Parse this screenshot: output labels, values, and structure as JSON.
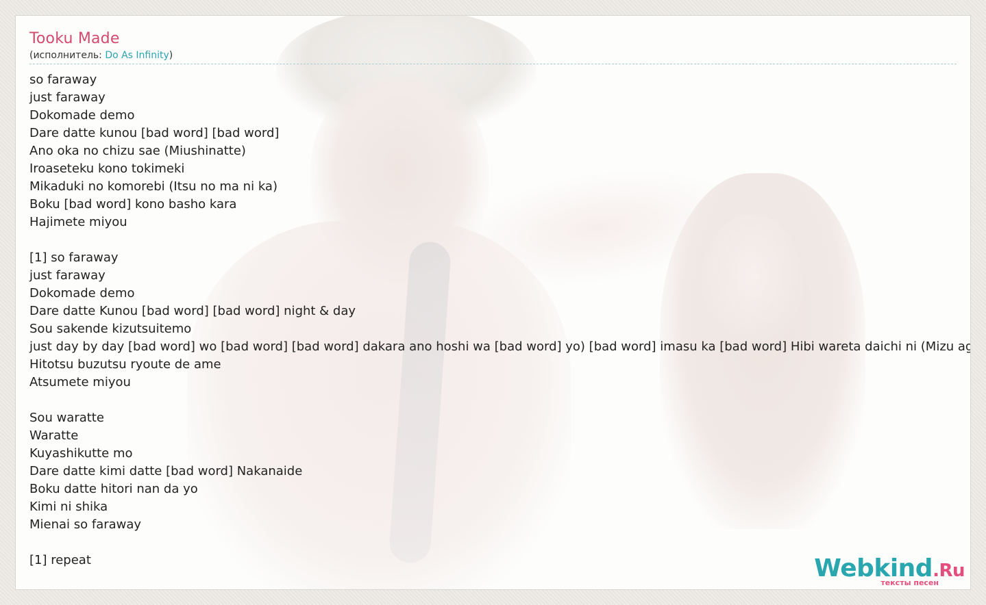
{
  "song": {
    "title": "Tooku Made",
    "artist_prefix": "(исполнитель: ",
    "artist_name": "Do As Infinity",
    "artist_suffix": ")"
  },
  "lyrics": [
    "so faraway",
    "just faraway",
    "Dokomade demo",
    "Dare datte kunou [bad word] [bad word]",
    "Ano oka no chizu sae (Miushinatte)",
    "Iroaseteku kono tokimeki",
    "Mikaduki no komorebi (Itsu no ma ni ka)",
    "Boku [bad word] kono basho kara",
    "Hajimete miyou",
    "",
    "[1] so faraway",
    "just faraway",
    "Dokomade demo",
    "Dare datte Kunou [bad word] [bad word] night & day",
    "Sou sakende kizutsuitemo",
    "just day by day [bad word] wo [bad word]  [bad word] dakara ano hoshi wa [bad word] yo) [bad word] imasu ka [bad word] Hibi wareta daichi ni (Mizu ageyou)",
    "Hitotsu buzutsu ryoute de ame",
    "Atsumete miyou",
    "",
    "Sou waratte",
    "Waratte",
    "Kuyashikutte mo",
    "Dare datte kimi datte [bad word] Nakanaide",
    "Boku datte hitori nan da yo",
    "Kimi ni shika",
    "Mienai so faraway",
    "",
    "[1] repeat"
  ],
  "logo": {
    "main": "Webkind",
    "suffix": ".Ru",
    "tagline": "тексты песен"
  }
}
